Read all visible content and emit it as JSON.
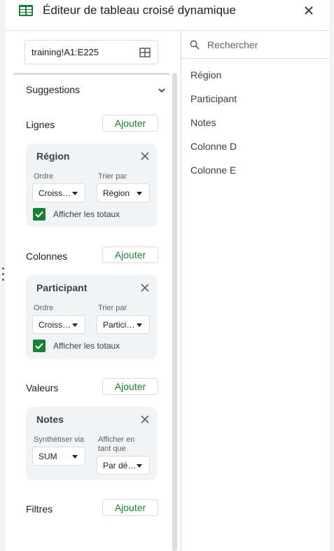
{
  "header": {
    "title": "Éditeur de tableau croisé dynamique"
  },
  "range": {
    "value": "training!A1:E225"
  },
  "suggestions": {
    "label": "Suggestions"
  },
  "sections": {
    "lignes": {
      "label": "Lignes",
      "add_label": "Ajouter"
    },
    "colonnes": {
      "label": "Colonnes",
      "add_label": "Ajouter"
    },
    "valeurs": {
      "label": "Valeurs",
      "add_label": "Ajouter"
    },
    "filtres": {
      "label": "Filtres",
      "add_label": "Ajouter"
    }
  },
  "rows_card": {
    "title": "Région",
    "order_label": "Ordre",
    "order_value": "Croiss…",
    "sort_label": "Trier par",
    "sort_value": "Région",
    "totals_label": "Afficher les totaux",
    "totals_checked": true
  },
  "columns_card": {
    "title": "Participant",
    "order_label": "Ordre",
    "order_value": "Croiss…",
    "sort_label": "Trier par",
    "sort_value": "Partici…",
    "totals_label": "Afficher les totaux",
    "totals_checked": true
  },
  "values_card": {
    "title": "Notes",
    "summarize_label": "Synthétiser via",
    "summarize_value": "SUM",
    "show_as_label": "Afficher en tant que",
    "show_as_value": "Par dé…"
  },
  "search": {
    "placeholder": "Rechercher"
  },
  "fields": [
    "Région",
    "Participant",
    "Notes",
    "Colonne D",
    "Colonne E"
  ],
  "colors": {
    "accent_green": "#188038",
    "card_bg": "#f1f3f4",
    "border": "#dadce0"
  },
  "icons": [
    "sheets-logo-icon",
    "close-icon",
    "grid-select-icon",
    "chevron-down-icon",
    "search-icon",
    "more-vert-icon",
    "checkmark-icon"
  ]
}
